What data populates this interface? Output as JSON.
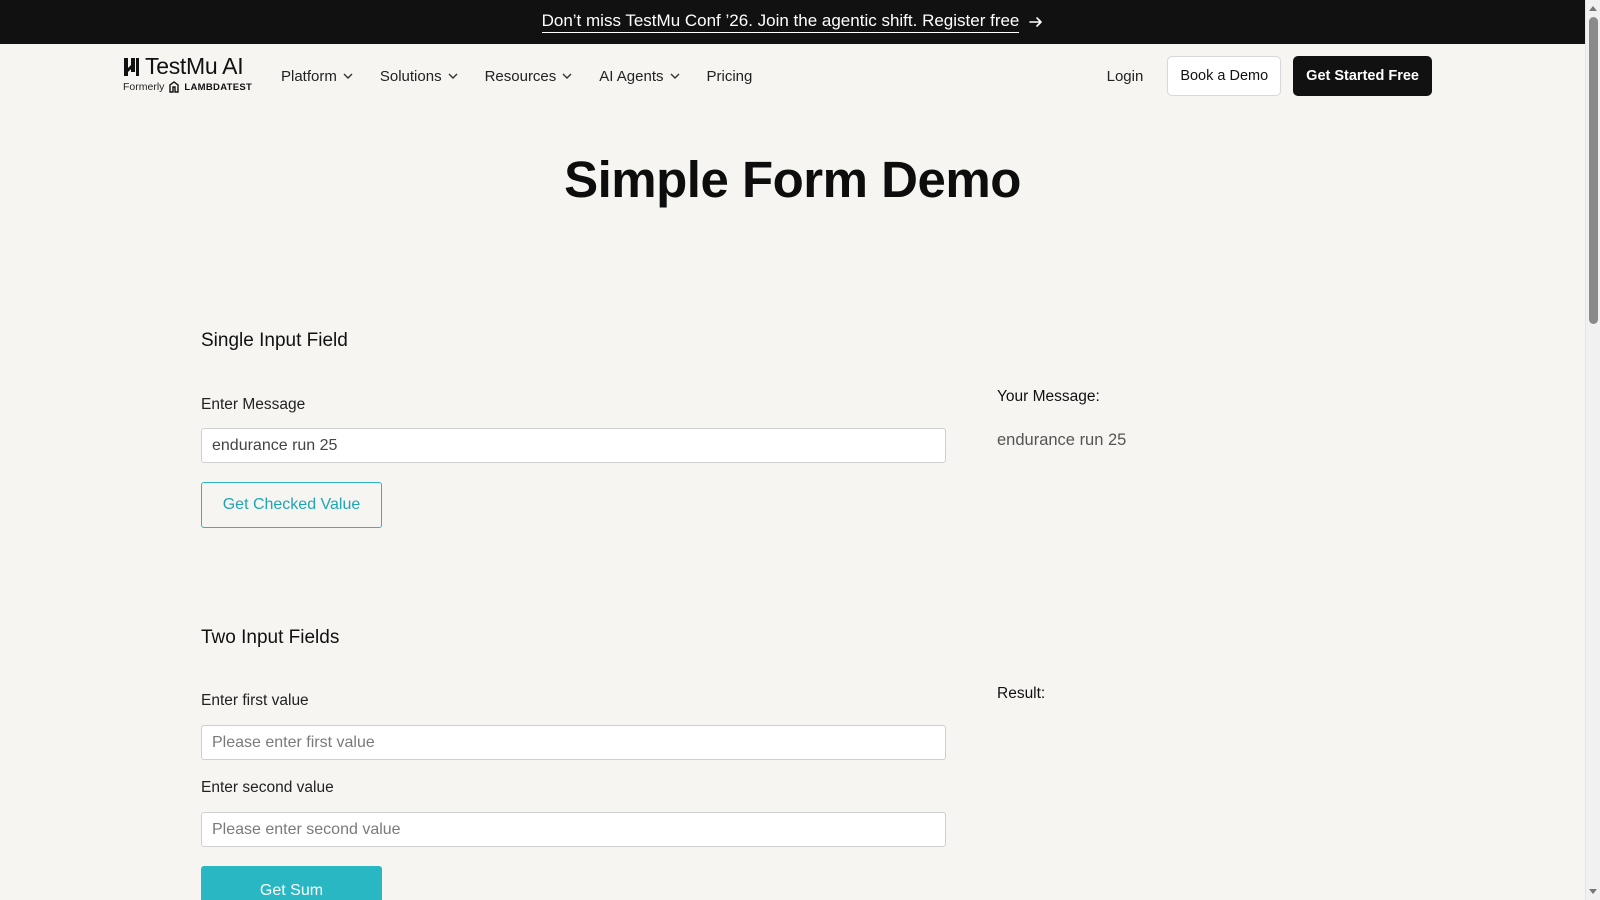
{
  "announcement": {
    "text": "Don’t miss TestMu Conf ’26. Join the agentic shift. Register free",
    "icon": "arrow-right-icon"
  },
  "header": {
    "logo_name": "TestMu AI",
    "logo_formerly": "Formerly",
    "logo_previous": "LAMBDATEST",
    "menu": [
      {
        "label": "Platform",
        "icon": "chevron-down-icon"
      },
      {
        "label": "Solutions",
        "icon": "chevron-down-icon"
      },
      {
        "label": "Resources",
        "icon": "chevron-down-icon"
      },
      {
        "label": "AI Agents",
        "icon": "chevron-down-icon"
      },
      {
        "label": "Pricing"
      }
    ],
    "login": "Login",
    "book_demo": "Book a Demo",
    "get_started": "Get Started Free"
  },
  "page_title": "Simple Form Demo",
  "single_input": {
    "title": "Single Input Field",
    "label": "Enter Message",
    "value": "endurance run 25",
    "button": "Get Checked Value",
    "output_label": "Your Message:",
    "output_value": "endurance run 25"
  },
  "two_inputs": {
    "title": "Two Input Fields",
    "first_label": "Enter first value",
    "first_placeholder": "Please enter first value",
    "first_value": "",
    "second_label": "Enter second value",
    "second_placeholder": "Please enter second value",
    "second_value": "",
    "button": "Get Sum",
    "result_label": "Result:"
  },
  "colors": {
    "background": "#f6f5f2",
    "dark": "#111111",
    "accent": "#29b7c4"
  }
}
